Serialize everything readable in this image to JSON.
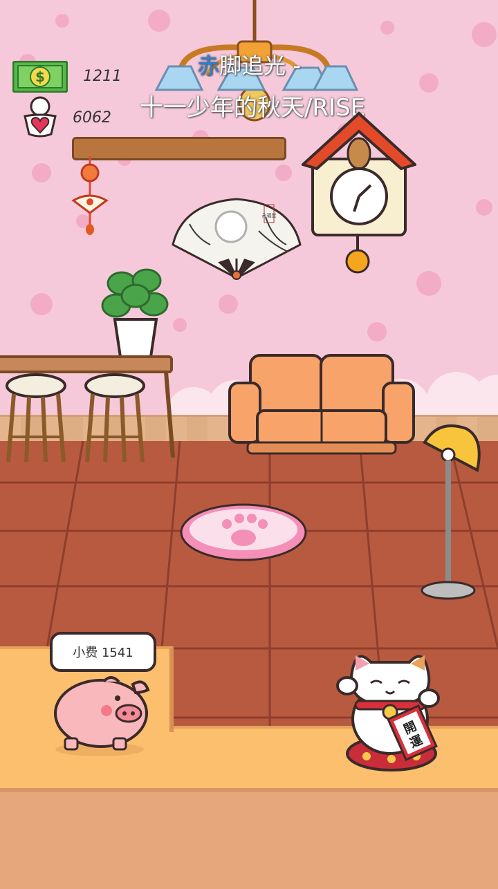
{
  "hud": {
    "money_value": "1211",
    "hearts_value": "6062",
    "money_icon": "dollar-bill-icon",
    "hearts_icon": "heart-person-icon"
  },
  "song": {
    "line1_accent": "赤",
    "line1_rest": "脚追光 -",
    "line2": "十一少年的秋天/RISE"
  },
  "piggy": {
    "tip_label": "小费 1541"
  },
  "lucky_cat": {
    "sign_text": "開運"
  },
  "fan": {
    "seal_text": "永福堂"
  },
  "colors": {
    "wall": "#f6c9da",
    "floor": "#b85a3f",
    "counter": "#fbbf6e",
    "sofa": "#f7a36a",
    "clock_roof": "#e24a2a"
  }
}
